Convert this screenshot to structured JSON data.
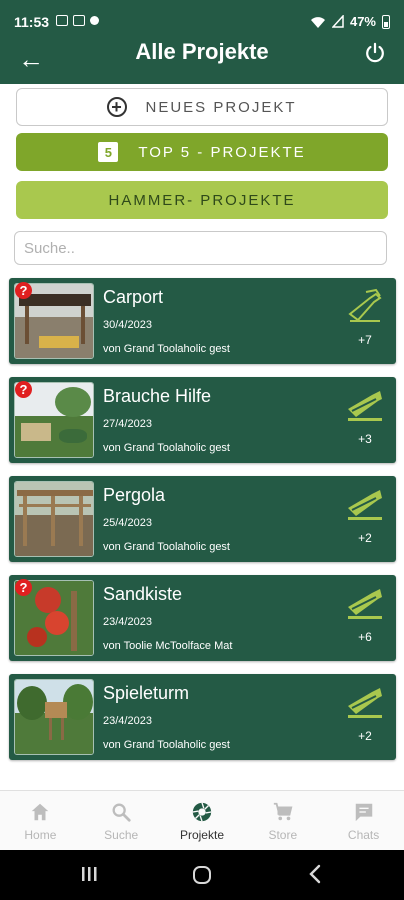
{
  "status": {
    "time": "11:53",
    "battery": "47%"
  },
  "appbar": {
    "title": "Alle Projekte"
  },
  "buttons": {
    "new_project": "NEUES PROJEKT",
    "top5_badge": "5",
    "top5": "TOP 5 - PROJEKTE",
    "hammer": "HAMMER- PROJEKTE"
  },
  "search": {
    "placeholder": "Suche.."
  },
  "projects": [
    {
      "name": "Carport",
      "date": "30/4/2023",
      "author": "von Grand Toolaholic gest",
      "count": "+7",
      "needs_help": true,
      "hammer_style": "outline"
    },
    {
      "name": "Brauche Hilfe",
      "date": "27/4/2023",
      "author": "von Grand Toolaholic gest",
      "count": "+3",
      "needs_help": true,
      "hammer_style": "filled"
    },
    {
      "name": "Pergola",
      "date": "25/4/2023",
      "author": "von Grand Toolaholic gest",
      "count": "+2",
      "needs_help": false,
      "hammer_style": "filled"
    },
    {
      "name": "Sandkiste",
      "date": "23/4/2023",
      "author": "von Toolie McToolface Mat",
      "count": "+6",
      "needs_help": true,
      "hammer_style": "filled"
    },
    {
      "name": "Spieleturm",
      "date": "23/4/2023",
      "author": "von Grand Toolaholic gest",
      "count": "+2",
      "needs_help": false,
      "hammer_style": "filled"
    }
  ],
  "help_badge": "?",
  "bottom_nav": [
    {
      "label": "Home",
      "icon": "home-icon"
    },
    {
      "label": "Suche",
      "icon": "search-icon"
    },
    {
      "label": "Projekte",
      "icon": "aperture-icon",
      "active": true
    },
    {
      "label": "Store",
      "icon": "cart-icon"
    },
    {
      "label": "Chats",
      "icon": "chat-icon"
    }
  ],
  "colors": {
    "primary": "#245a45",
    "top5": "#7fa62a",
    "hammer_btn": "#a9c84e",
    "hammer_icon": "#a9c84e",
    "help_badge": "#e02020"
  }
}
